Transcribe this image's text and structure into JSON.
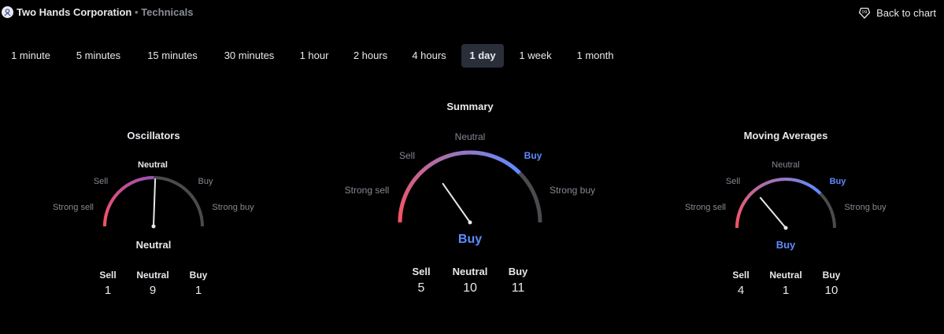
{
  "header": {
    "company": "Two Hands Corporation",
    "separator": "•",
    "section": "Technicals",
    "back_label": "Back to chart",
    "logo_icon": "company-logo-icon",
    "back_icon": "chart-pin-icon"
  },
  "intervals": [
    {
      "label": "1 minute",
      "active": false
    },
    {
      "label": "5 minutes",
      "active": false
    },
    {
      "label": "15 minutes",
      "active": false
    },
    {
      "label": "30 minutes",
      "active": false
    },
    {
      "label": "1 hour",
      "active": false
    },
    {
      "label": "2 hours",
      "active": false
    },
    {
      "label": "4 hours",
      "active": false
    },
    {
      "label": "1 day",
      "active": true
    },
    {
      "label": "1 week",
      "active": false
    },
    {
      "label": "1 month",
      "active": false
    }
  ],
  "colors": {
    "background": "#000000",
    "sell": "#f7525f",
    "neutral_arc": "#9c4fb8",
    "buy": "#5e8bff",
    "track": "#4a4a4f"
  },
  "gauges": {
    "oscillators": {
      "title": "Oscillators",
      "labels": {
        "strong_sell": "Strong sell",
        "sell": "Sell",
        "neutral": "Neutral",
        "buy": "Buy",
        "strong_buy": "Strong buy"
      },
      "result": "Neutral",
      "counts": {
        "sell_label": "Sell",
        "sell": "1",
        "neutral_label": "Neutral",
        "neutral": "9",
        "buy_label": "Buy",
        "buy": "1"
      }
    },
    "summary": {
      "title": "Summary",
      "labels": {
        "strong_sell": "Strong sell",
        "sell": "Sell",
        "neutral": "Neutral",
        "buy": "Buy",
        "strong_buy": "Strong buy"
      },
      "result": "Buy",
      "counts": {
        "sell_label": "Sell",
        "sell": "5",
        "neutral_label": "Neutral",
        "neutral": "10",
        "buy_label": "Buy",
        "buy": "11"
      }
    },
    "moving_averages": {
      "title": "Moving Averages",
      "labels": {
        "strong_sell": "Strong sell",
        "sell": "Sell",
        "neutral": "Neutral",
        "buy": "Buy",
        "strong_buy": "Strong buy"
      },
      "result": "Buy",
      "counts": {
        "sell_label": "Sell",
        "sell": "4",
        "neutral_label": "Neutral",
        "neutral": "1",
        "buy_label": "Buy",
        "buy": "10"
      }
    }
  }
}
